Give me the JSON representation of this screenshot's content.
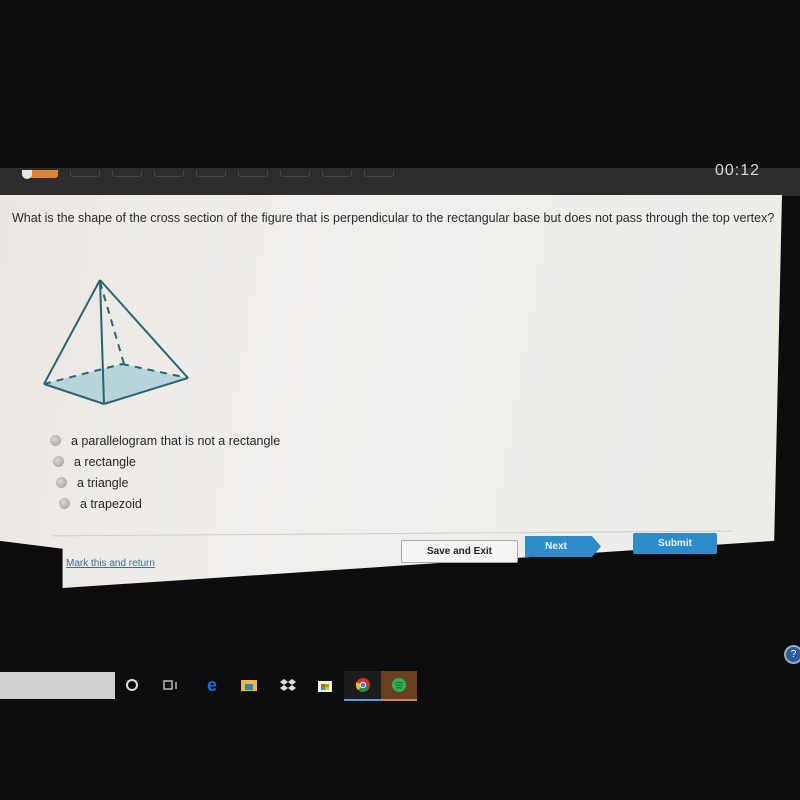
{
  "header": {
    "timer": "00:12",
    "question_nav": {
      "current_index": 1,
      "total_visible": 9
    }
  },
  "question": {
    "text": "What is the shape of the cross section of the figure that is perpendicular to the rectangular base but does not pass through the top vertex?",
    "figure": "rectangular-pyramid"
  },
  "options": [
    {
      "label": "a parallelogram that is not a rectangle",
      "selected": false
    },
    {
      "label": "a rectangle",
      "selected": false
    },
    {
      "label": "a triangle",
      "selected": false
    },
    {
      "label": "a trapezoid",
      "selected": false
    }
  ],
  "footer": {
    "mark_link": "Mark this and return",
    "save_label": "Save and Exit",
    "next_label": "Next",
    "submit_label": "Submit"
  },
  "taskbar": {
    "icons": [
      "cortana-icon",
      "task-view-icon",
      "edge-icon",
      "file-explorer-icon",
      "dropbox-icon",
      "store-icon",
      "chrome-icon",
      "spotify-icon"
    ],
    "help_icon": "help-icon"
  },
  "colors": {
    "accent": "#2e8ccb",
    "progress": "#e0822e"
  }
}
